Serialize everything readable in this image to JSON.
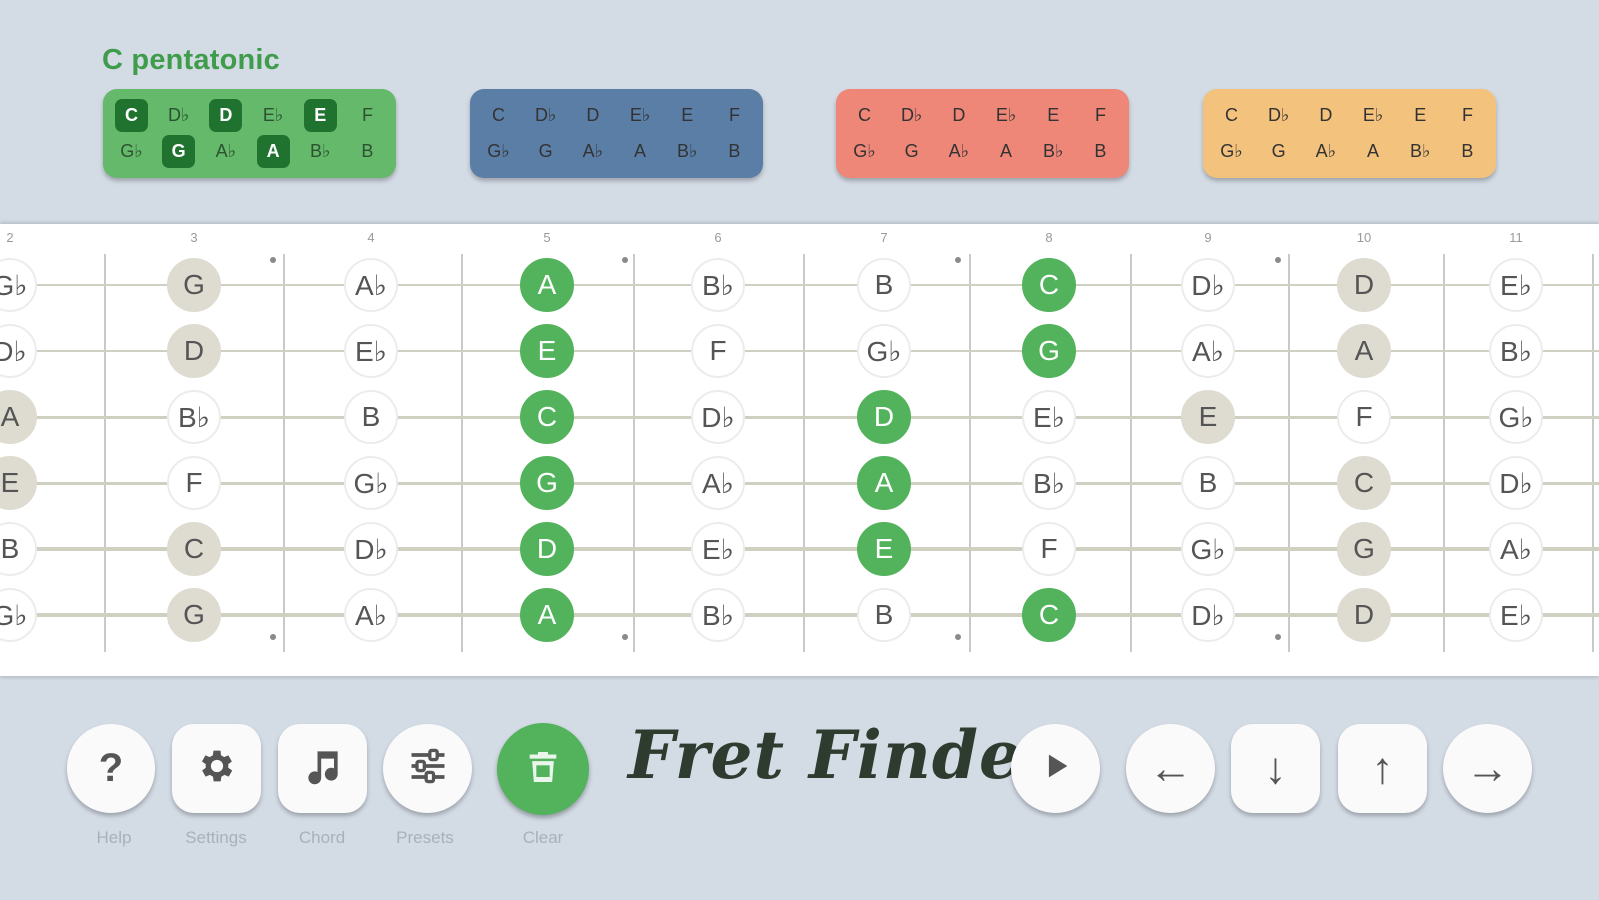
{
  "scale_title": "C pentatonic",
  "palettes": [
    {
      "color": "#64b96b",
      "row1": [
        {
          "n": "C",
          "on": true
        },
        {
          "n": "D♭",
          "on": false
        },
        {
          "n": "D",
          "on": true
        },
        {
          "n": "E♭",
          "on": false
        },
        {
          "n": "E",
          "on": true
        },
        {
          "n": "F",
          "on": false
        }
      ],
      "row2": [
        {
          "n": "G♭",
          "on": false
        },
        {
          "n": "G",
          "on": true
        },
        {
          "n": "A♭",
          "on": false
        },
        {
          "n": "A",
          "on": true
        },
        {
          "n": "B♭",
          "on": false
        },
        {
          "n": "B",
          "on": false
        }
      ]
    },
    {
      "color": "#5b7ea6",
      "row1": [
        {
          "n": "C",
          "on": false
        },
        {
          "n": "D♭",
          "on": false
        },
        {
          "n": "D",
          "on": false
        },
        {
          "n": "E♭",
          "on": false
        },
        {
          "n": "E",
          "on": false
        },
        {
          "n": "F",
          "on": false
        }
      ],
      "row2": [
        {
          "n": "G♭",
          "on": false
        },
        {
          "n": "G",
          "on": false
        },
        {
          "n": "A♭",
          "on": false
        },
        {
          "n": "A",
          "on": false
        },
        {
          "n": "B♭",
          "on": false
        },
        {
          "n": "B",
          "on": false
        }
      ]
    },
    {
      "color": "#ef8778",
      "row1": [
        {
          "n": "C",
          "on": false
        },
        {
          "n": "D♭",
          "on": false
        },
        {
          "n": "D",
          "on": false
        },
        {
          "n": "E♭",
          "on": false
        },
        {
          "n": "E",
          "on": false
        },
        {
          "n": "F",
          "on": false
        }
      ],
      "row2": [
        {
          "n": "G♭",
          "on": false
        },
        {
          "n": "G",
          "on": false
        },
        {
          "n": "A♭",
          "on": false
        },
        {
          "n": "A",
          "on": false
        },
        {
          "n": "B♭",
          "on": false
        },
        {
          "n": "B",
          "on": false
        }
      ]
    },
    {
      "color": "#f3c27c",
      "row1": [
        {
          "n": "C",
          "on": false
        },
        {
          "n": "D♭",
          "on": false
        },
        {
          "n": "D",
          "on": false
        },
        {
          "n": "E♭",
          "on": false
        },
        {
          "n": "E",
          "on": false
        },
        {
          "n": "F",
          "on": false
        }
      ],
      "row2": [
        {
          "n": "G♭",
          "on": false
        },
        {
          "n": "G",
          "on": false
        },
        {
          "n": "A♭",
          "on": false
        },
        {
          "n": "A",
          "on": false
        },
        {
          "n": "B♭",
          "on": false
        },
        {
          "n": "B",
          "on": false
        }
      ]
    }
  ],
  "fretboard": {
    "fret_numbers": [
      "2",
      "3",
      "4",
      "5",
      "6",
      "7",
      "8",
      "9",
      "10",
      "11"
    ],
    "strings": [
      [
        "G♭",
        "G",
        "A♭",
        "A",
        "B♭",
        "B",
        "C",
        "D♭",
        "D",
        "E♭"
      ],
      [
        "D♭",
        "D",
        "E♭",
        "E",
        "F",
        "G♭",
        "G",
        "A♭",
        "A",
        "B♭"
      ],
      [
        "A",
        "B♭",
        "B",
        "C",
        "D♭",
        "D",
        "E♭",
        "E",
        "F",
        "G♭"
      ],
      [
        "E",
        "F",
        "G♭",
        "G",
        "A♭",
        "A",
        "B♭",
        "B",
        "C",
        "D♭"
      ],
      [
        "B",
        "C",
        "D♭",
        "D",
        "E♭",
        "E",
        "F",
        "G♭",
        "G",
        "A♭"
      ],
      [
        "G♭",
        "G",
        "A♭",
        "A",
        "B♭",
        "B",
        "C",
        "D♭",
        "D",
        "E♭"
      ]
    ],
    "states": [
      [
        "off",
        "scale",
        "off",
        "active",
        "off",
        "off",
        "active",
        "off",
        "scale",
        "off"
      ],
      [
        "off",
        "scale",
        "off",
        "active",
        "off",
        "off",
        "active",
        "off",
        "scale",
        "off"
      ],
      [
        "scale",
        "off",
        "off",
        "active",
        "off",
        "active",
        "off",
        "scale",
        "off",
        "off"
      ],
      [
        "scale",
        "off",
        "off",
        "active",
        "off",
        "active",
        "off",
        "off",
        "scale",
        "off"
      ],
      [
        "off",
        "scale",
        "off",
        "active",
        "off",
        "active",
        "off",
        "off",
        "scale",
        "off"
      ],
      [
        "off",
        "scale",
        "off",
        "active",
        "off",
        "off",
        "active",
        "off",
        "scale",
        "off"
      ]
    ]
  },
  "toolbar": {
    "help_icon": "?",
    "help_label": "Help",
    "settings_label": "Settings",
    "chord_label": "Chord",
    "presets_label": "Presets",
    "clear_label": "Clear",
    "app_title": "Fret Finder",
    "play_icon": "play-icon",
    "left_arrow": "←",
    "down_arrow": "↓",
    "up_arrow": "↑",
    "right_arrow": "→"
  },
  "colors": {
    "background": "#d3dbe5",
    "active_note": "#52b35c",
    "scale_note": "#dedbd1",
    "accent_green": "#3f9c4b"
  }
}
